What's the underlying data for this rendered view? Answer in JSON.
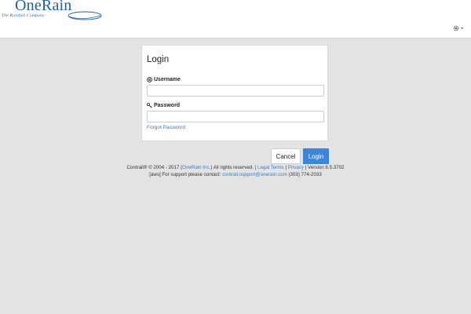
{
  "header": {
    "logo_text": "OneRain",
    "logo_tagline": "The Rainfall Company",
    "settings_icon": "gear-icon"
  },
  "login": {
    "title": "Login",
    "username_label": "Username",
    "username_value": "",
    "password_label": "Password",
    "password_value": "",
    "forgot_password": "Forgot Password",
    "cancel_label": "Cancel",
    "login_label": "Login",
    "login_button_color": "#3c86d8"
  },
  "footer": {
    "copyright_prefix": "Contrail® © 2004 - 2017 (",
    "company_link": "OneRain Inc.",
    "rights": ") All rights reserved. |",
    "legal_terms": "Legal Terms",
    "sep": "|",
    "privacy": "Privacy",
    "version": "| Version 6.5.3702",
    "support_prefix": "[aws] For support please contact:",
    "support_email": "contrail.support@onerain.com",
    "support_phone": "(303) 774-2033"
  },
  "colors": {
    "brand_blue": "#1f5fa8",
    "link": "#3a7fc1",
    "background": "#e3e3e3"
  }
}
